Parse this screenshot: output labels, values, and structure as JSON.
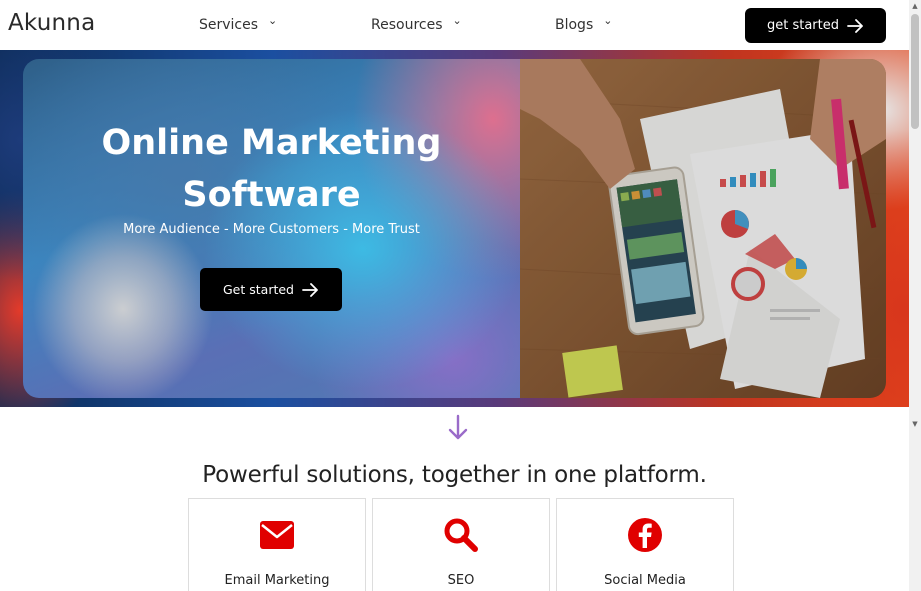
{
  "brand": {
    "logo": "Akunna",
    "accent": "#e00000",
    "purple": "#9a6bc9"
  },
  "nav": {
    "items": [
      {
        "label": "Services",
        "chevron": "chevron-down-icon"
      },
      {
        "label": "Resources",
        "chevron": "chevron-down-icon"
      },
      {
        "label": "Blogs",
        "chevron": "chevron-down-icon"
      }
    ],
    "cta_label": "get started"
  },
  "hero": {
    "title_line1": "Online Marketing",
    "title_line2": "Software",
    "subtitle": "More Audience - More Customers - More Trust",
    "button_label": "Get started",
    "image": "tablet-with-marketing-charts-on-desk"
  },
  "section": {
    "title": "Powerful solutions, together in one platform.",
    "cards": [
      {
        "label": "Email Marketing",
        "icon": "envelope-icon"
      },
      {
        "label": "SEO",
        "icon": "search-icon"
      },
      {
        "label": "Social Media",
        "icon": "facebook-icon"
      }
    ]
  }
}
